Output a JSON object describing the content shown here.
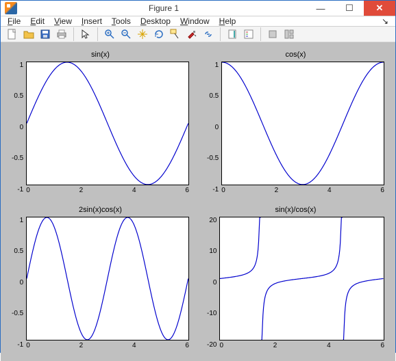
{
  "window": {
    "title": "Figure 1"
  },
  "menubar": {
    "items": [
      "File",
      "Edit",
      "View",
      "Insert",
      "Tools",
      "Desktop",
      "Window",
      "Help"
    ]
  },
  "toolbar": {
    "icons": [
      "new-figure",
      "open",
      "save",
      "print",
      "cursor",
      "zoom-in",
      "zoom-out",
      "pan",
      "rotate",
      "data-cursor",
      "brush",
      "link",
      "insert-colorbar",
      "insert-legend",
      "hide-tools",
      "show-tools"
    ]
  },
  "chart_data": [
    {
      "type": "line",
      "title": "sin(x)",
      "xlabel": "",
      "ylabel": "",
      "xlim": [
        0,
        6.283
      ],
      "ylim": [
        -1,
        1
      ],
      "xticks": [
        0,
        2,
        4,
        6
      ],
      "yticks": [
        -1,
        -0.5,
        0,
        0.5,
        1
      ],
      "series": [
        {
          "name": "sin(x)",
          "fn": "sin"
        }
      ]
    },
    {
      "type": "line",
      "title": "cos(x)",
      "xlabel": "",
      "ylabel": "",
      "xlim": [
        0,
        6.283
      ],
      "ylim": [
        -1,
        1
      ],
      "xticks": [
        0,
        2,
        4,
        6
      ],
      "yticks": [
        -1,
        -0.5,
        0,
        0.5,
        1
      ],
      "series": [
        {
          "name": "cos(x)",
          "fn": "cos"
        }
      ]
    },
    {
      "type": "line",
      "title": "2sin(x)cos(x)",
      "xlabel": "",
      "ylabel": "",
      "xlim": [
        0,
        6.283
      ],
      "ylim": [
        -1,
        1
      ],
      "xticks": [
        0,
        2,
        4,
        6
      ],
      "yticks": [
        -1,
        -0.5,
        0,
        0.5,
        1
      ],
      "series": [
        {
          "name": "sin(2x)",
          "fn": "sin2x"
        }
      ]
    },
    {
      "type": "line",
      "title": "sin(x)/cos(x)",
      "xlabel": "",
      "ylabel": "",
      "xlim": [
        0,
        6.283
      ],
      "ylim": [
        -20,
        20
      ],
      "xticks": [
        0,
        2,
        4,
        6
      ],
      "yticks": [
        -20,
        -10,
        0,
        10,
        20
      ],
      "series": [
        {
          "name": "tan(x)",
          "fn": "tan"
        }
      ]
    }
  ]
}
